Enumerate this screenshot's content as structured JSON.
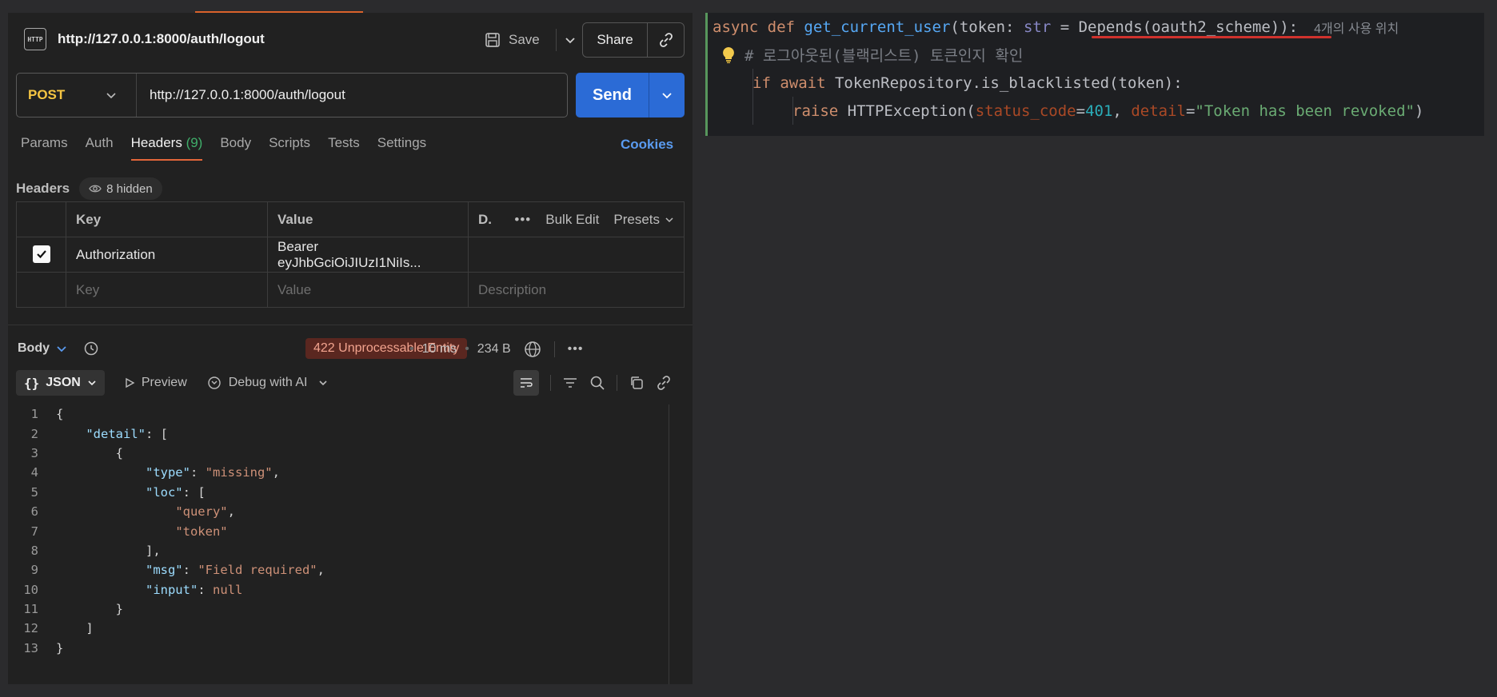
{
  "postman": {
    "tab_url": "http://127.0.0.1:8000/auth/logout",
    "save_label": "Save",
    "share_label": "Share",
    "method": "POST",
    "request_url": "http://127.0.0.1:8000/auth/logout",
    "send_label": "Send",
    "tabs": [
      {
        "label": "Params"
      },
      {
        "label": "Auth"
      },
      {
        "label": "Headers",
        "count": "(9)",
        "active": true
      },
      {
        "label": "Body"
      },
      {
        "label": "Scripts"
      },
      {
        "label": "Tests"
      },
      {
        "label": "Settings"
      }
    ],
    "cookies_label": "Cookies",
    "headers_title": "Headers",
    "hidden_label": "8 hidden",
    "table": {
      "col_key": "Key",
      "col_value": "Value",
      "col_desc": "D.",
      "bulk_edit": "Bulk Edit",
      "presets": "Presets",
      "rows": [
        {
          "checked": true,
          "key": "Authorization",
          "value": "Bearer eyJhbGciOiJIUzI1NiIs..."
        }
      ],
      "placeholder_key": "Key",
      "placeholder_value": "Value",
      "placeholder_desc": "Description"
    },
    "response": {
      "body_label": "Body",
      "status": "422 Unprocessable Entity",
      "status_color": "#5a2720",
      "time": "10 ms",
      "size": "234 B",
      "format": "JSON",
      "preview_label": "Preview",
      "debug_label": "Debug with AI"
    }
  },
  "ide": {
    "usage_hint": "4개의 사용 위치",
    "comment": "# 로그아웃된(블랙리스트) 토큰인지 확인",
    "status_code_value": "401",
    "detail_value": "\"Token has been revoked\""
  }
}
